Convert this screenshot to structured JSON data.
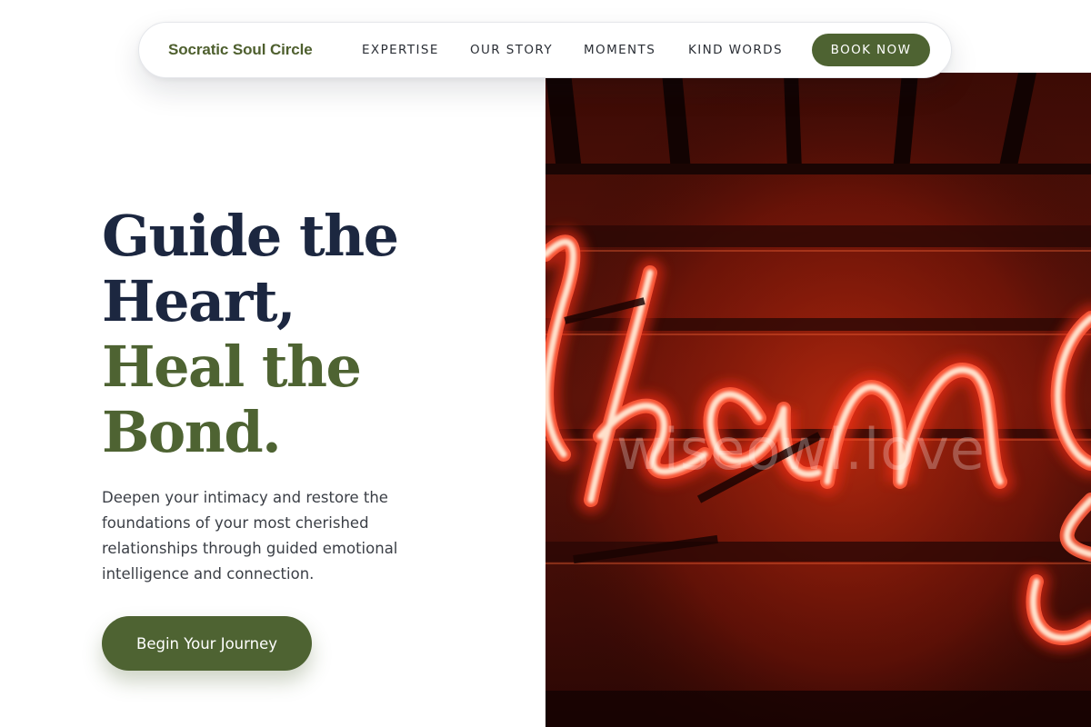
{
  "nav": {
    "brand": "Socratic Soul Circle",
    "links": [
      {
        "label": "EXPERTISE"
      },
      {
        "label": "OUR STORY"
      },
      {
        "label": "MOMENTS"
      },
      {
        "label": "KIND WORDS"
      }
    ],
    "cta": "BOOK NOW"
  },
  "hero": {
    "title_lines": [
      "Guide the",
      "Heart,",
      "Heal the",
      "Bond."
    ],
    "description": "Deepen your intimacy and restore the foundations of your most cherished relationships through guided emotional intelligence and connection.",
    "cta": "Begin Your Journey",
    "image": {
      "subject": "red-neon-sign",
      "watermark": "wiseowl.love"
    }
  },
  "colors": {
    "brand_green": "#4e6332",
    "heading_navy": "#1c2740",
    "body_text": "#3b3f46",
    "neon_red": "#ff3b1e",
    "neon_warm": "#ffd9c0"
  }
}
